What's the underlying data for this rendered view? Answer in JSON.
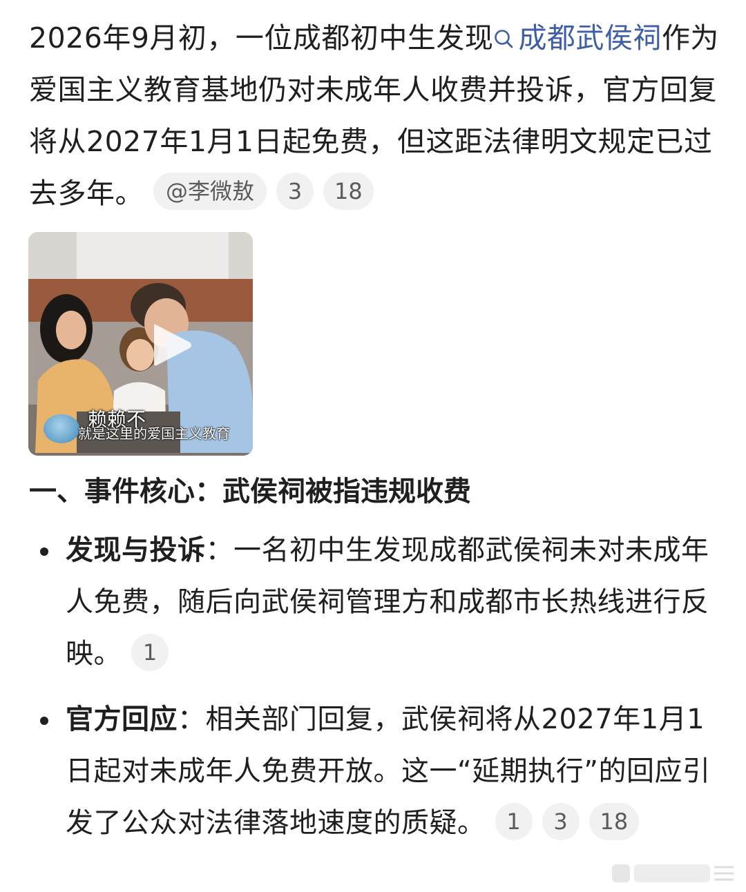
{
  "intro": {
    "text_before": "2026年9月初，一位成都初中生发现",
    "link_label": "成都武侯祠",
    "text_after": "作为爱国主义教育基地仍对未成年人收费并投诉，官方回复将从2027年1月1日起免费，但这距法律明文规定已过去多年。",
    "source_chip": "@李微敖",
    "ref_chips": [
      "3",
      "18"
    ]
  },
  "video": {
    "caption_small": "就是这里的爱国主义教育",
    "caption_big": "赖赖不"
  },
  "section": {
    "title": "一、事件核心：武侯祠被指违规收费"
  },
  "bullets": [
    {
      "label": "发现与投诉",
      "text": "：一名初中生发现成都武侯祠未对未成年人免费，随后向武侯祠管理方和成都市长热线进行反映。",
      "refs": [
        "1"
      ]
    },
    {
      "label": "官方回应",
      "text": "：相关部门回复，武侯祠将从2027年1月1日起对未成年人免费开放。这一“延期执行”的回应引发了公众对法律落地速度的质疑。",
      "refs": [
        "1",
        "3",
        "18"
      ]
    }
  ],
  "colors": {
    "link": "#3f5ea8",
    "chip_bg": "#f1f1f2",
    "text": "#1f1f1f"
  }
}
